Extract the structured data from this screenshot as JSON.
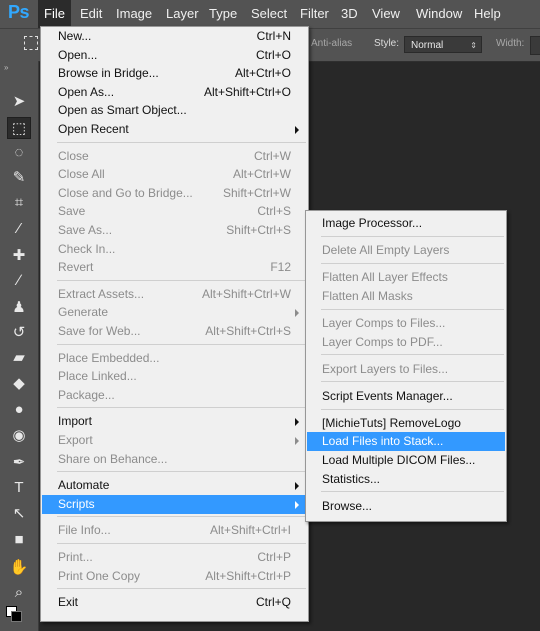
{
  "app": {
    "logo": "Ps"
  },
  "menubar": [
    {
      "label": "File",
      "active": true
    },
    {
      "label": "Edit"
    },
    {
      "label": "Image"
    },
    {
      "label": "Layer"
    },
    {
      "label": "Type"
    },
    {
      "label": "Select"
    },
    {
      "label": "Filter"
    },
    {
      "label": "3D"
    },
    {
      "label": "View"
    },
    {
      "label": "Window"
    },
    {
      "label": "Help"
    }
  ],
  "options": {
    "antialias_label": "Anti-alias",
    "style_label": "Style:",
    "style_value": "Normal",
    "width_label": "Width:"
  },
  "file_menu": [
    {
      "label": "New...",
      "shortcut": "Ctrl+N"
    },
    {
      "label": "Open...",
      "shortcut": "Ctrl+O"
    },
    {
      "label": "Browse in Bridge...",
      "shortcut": "Alt+Ctrl+O"
    },
    {
      "label": "Open As...",
      "shortcut": "Alt+Shift+Ctrl+O"
    },
    {
      "label": "Open as Smart Object..."
    },
    {
      "label": "Open Recent",
      "submenu": true
    },
    {
      "separator": true
    },
    {
      "label": "Close",
      "shortcut": "Ctrl+W",
      "disabled": true
    },
    {
      "label": "Close All",
      "shortcut": "Alt+Ctrl+W",
      "disabled": true
    },
    {
      "label": "Close and Go to Bridge...",
      "shortcut": "Shift+Ctrl+W",
      "disabled": true
    },
    {
      "label": "Save",
      "shortcut": "Ctrl+S",
      "disabled": true
    },
    {
      "label": "Save As...",
      "shortcut": "Shift+Ctrl+S",
      "disabled": true
    },
    {
      "label": "Check In...",
      "disabled": true
    },
    {
      "label": "Revert",
      "shortcut": "F12",
      "disabled": true
    },
    {
      "separator": true
    },
    {
      "label": "Extract Assets...",
      "shortcut": "Alt+Shift+Ctrl+W",
      "disabled": true
    },
    {
      "label": "Generate",
      "submenu": true,
      "disabled": true
    },
    {
      "label": "Save for Web...",
      "shortcut": "Alt+Shift+Ctrl+S",
      "disabled": true
    },
    {
      "separator": true
    },
    {
      "label": "Place Embedded...",
      "disabled": true
    },
    {
      "label": "Place Linked...",
      "disabled": true
    },
    {
      "label": "Package...",
      "disabled": true
    },
    {
      "separator": true
    },
    {
      "label": "Import",
      "submenu": true
    },
    {
      "label": "Export",
      "submenu": true,
      "disabled": true
    },
    {
      "label": "Share on Behance...",
      "disabled": true
    },
    {
      "separator": true
    },
    {
      "label": "Automate",
      "submenu": true
    },
    {
      "label": "Scripts",
      "submenu": true,
      "highlighted": true
    },
    {
      "separator": true
    },
    {
      "label": "File Info...",
      "shortcut": "Alt+Shift+Ctrl+I",
      "disabled": true
    },
    {
      "separator": true
    },
    {
      "label": "Print...",
      "shortcut": "Ctrl+P",
      "disabled": true
    },
    {
      "label": "Print One Copy",
      "shortcut": "Alt+Shift+Ctrl+P",
      "disabled": true
    },
    {
      "separator": true
    },
    {
      "label": "Exit",
      "shortcut": "Ctrl+Q"
    }
  ],
  "scripts_menu": [
    {
      "label": "Image Processor..."
    },
    {
      "separator": true
    },
    {
      "label": "Delete All Empty Layers",
      "disabled": true
    },
    {
      "separator": true
    },
    {
      "label": "Flatten All Layer Effects",
      "disabled": true
    },
    {
      "label": "Flatten All Masks",
      "disabled": true
    },
    {
      "separator": true
    },
    {
      "label": "Layer Comps to Files...",
      "disabled": true
    },
    {
      "label": "Layer Comps to PDF...",
      "disabled": true
    },
    {
      "separator": true
    },
    {
      "label": "Export Layers to Files...",
      "disabled": true
    },
    {
      "separator": true
    },
    {
      "label": "Script Events Manager..."
    },
    {
      "separator": true
    },
    {
      "label": "[MichieTuts] RemoveLogo"
    },
    {
      "label": "Load Files into Stack...",
      "highlighted": true
    },
    {
      "label": "Load Multiple DICOM Files..."
    },
    {
      "label": "Statistics..."
    },
    {
      "separator": true
    },
    {
      "label": "Browse..."
    }
  ],
  "tools": [
    {
      "icon": "move-tool-icon",
      "glyph": "➤"
    },
    {
      "icon": "rectangular-marquee-icon",
      "glyph": "⬚",
      "selected": true
    },
    {
      "icon": "lasso-icon",
      "glyph": "◌"
    },
    {
      "icon": "quick-selection-icon",
      "glyph": "✎"
    },
    {
      "icon": "crop-icon",
      "glyph": "⌗"
    },
    {
      "icon": "eyedropper-icon",
      "glyph": "⁄"
    },
    {
      "icon": "spot-healing-icon",
      "glyph": "✚"
    },
    {
      "icon": "brush-icon",
      "glyph": "∕"
    },
    {
      "icon": "clone-stamp-icon",
      "glyph": "♟"
    },
    {
      "icon": "history-brush-icon",
      "glyph": "↺"
    },
    {
      "icon": "eraser-icon",
      "glyph": "▰"
    },
    {
      "icon": "paint-bucket-icon",
      "glyph": "◆"
    },
    {
      "icon": "blur-icon",
      "glyph": "●"
    },
    {
      "icon": "dodge-icon",
      "glyph": "◉"
    },
    {
      "icon": "pen-icon",
      "glyph": "✒"
    },
    {
      "icon": "type-icon",
      "glyph": "T"
    },
    {
      "icon": "path-selection-icon",
      "glyph": "↖"
    },
    {
      "icon": "rectangle-shape-icon",
      "glyph": "■"
    },
    {
      "icon": "hand-icon",
      "glyph": "✋"
    },
    {
      "icon": "zoom-icon",
      "glyph": "⌕"
    }
  ]
}
